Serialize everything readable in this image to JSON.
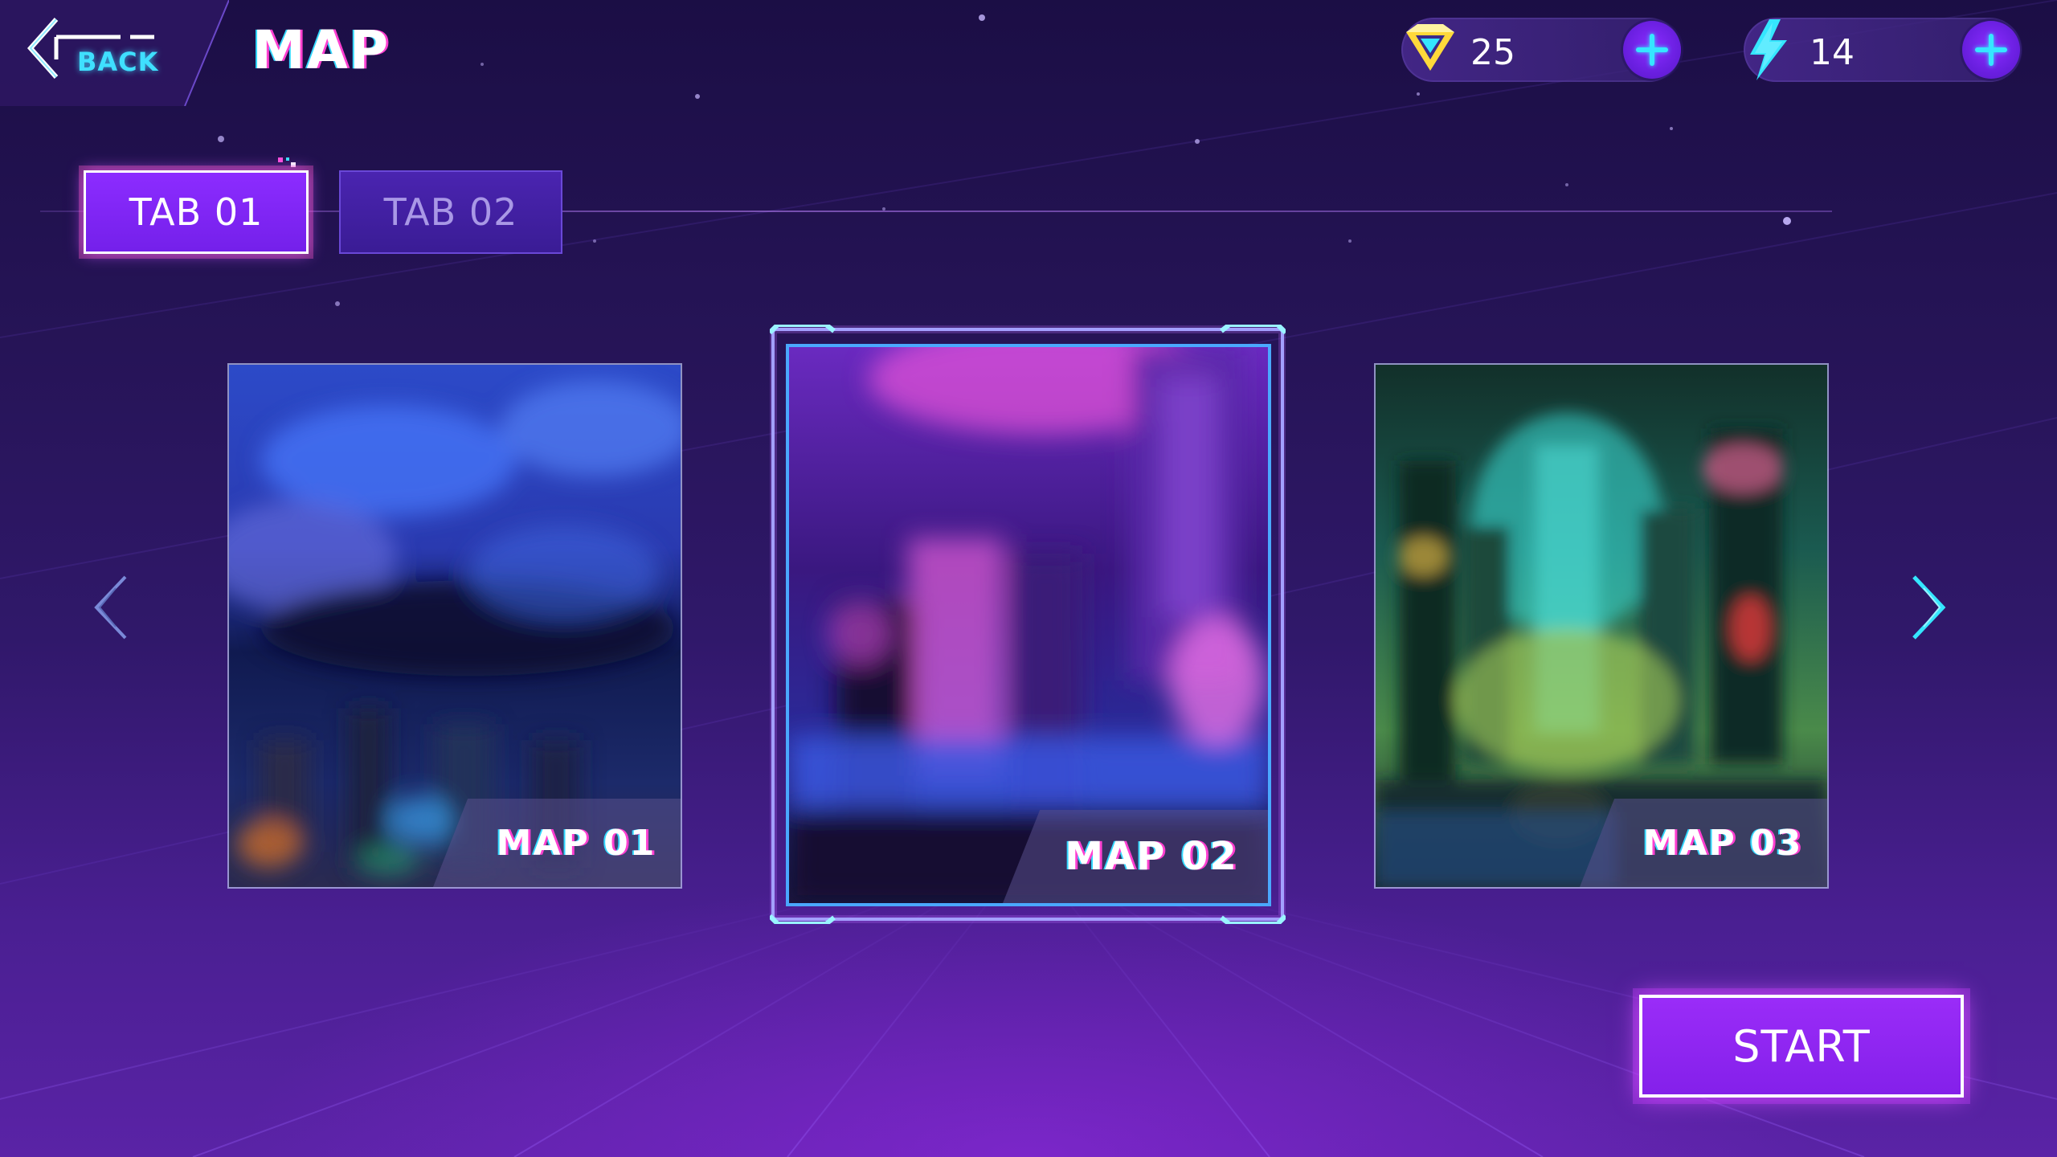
{
  "header": {
    "back_label": "BACK",
    "title": "MAP"
  },
  "currencies": {
    "gems": {
      "icon": "gem-icon",
      "value": "25"
    },
    "energy": {
      "icon": "lightning-icon",
      "value": "14"
    }
  },
  "tabs": [
    {
      "label": "TAB 01",
      "active": true
    },
    {
      "label": "TAB 02",
      "active": false
    }
  ],
  "maps": [
    {
      "label": "MAP 01",
      "selected": false,
      "theme": "blue-night-city"
    },
    {
      "label": "MAP 02",
      "selected": true,
      "theme": "purple-neon-city"
    },
    {
      "label": "MAP 03",
      "selected": false,
      "theme": "green-cyber-city"
    }
  ],
  "navigation": {
    "prev_icon": "chevron-left-icon",
    "next_icon": "chevron-right-icon"
  },
  "start_label": "START",
  "colors": {
    "accent_cyan": "#35e6ff",
    "accent_purple": "#8c2cff",
    "accent_pink": "#ff3fd0",
    "background": "#2a1560"
  }
}
